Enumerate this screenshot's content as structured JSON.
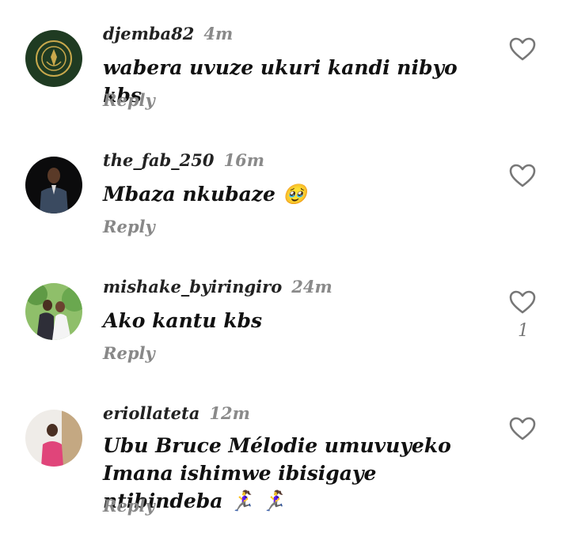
{
  "comments": [
    {
      "username": "djemba82",
      "time": "4m",
      "text": "wabera uvuze ukuri kandi nibyo kbs",
      "reply": "Reply",
      "likes": ""
    },
    {
      "username": "the_fab_250",
      "time": "16m",
      "text": "Mbaza nkubaze 🥹",
      "reply": "Reply",
      "likes": ""
    },
    {
      "username": "mishake_byiringiro",
      "time": "24m",
      "text": "Ako kantu kbs",
      "reply": "Reply",
      "likes": "1"
    },
    {
      "username": "eriollateta",
      "time": "12m",
      "text": "Ubu Bruce Mélodie umuvuyeko Imana ishimwe ibisigaye ntibindeba 🏃‍♀️ 🏃‍♀️",
      "reply": "Reply",
      "likes": ""
    }
  ],
  "colors": {
    "text": "#111111",
    "muted": "#8a8a8a",
    "heart_outline": "#777777"
  },
  "icons": {
    "like": "heart-outline-icon"
  }
}
